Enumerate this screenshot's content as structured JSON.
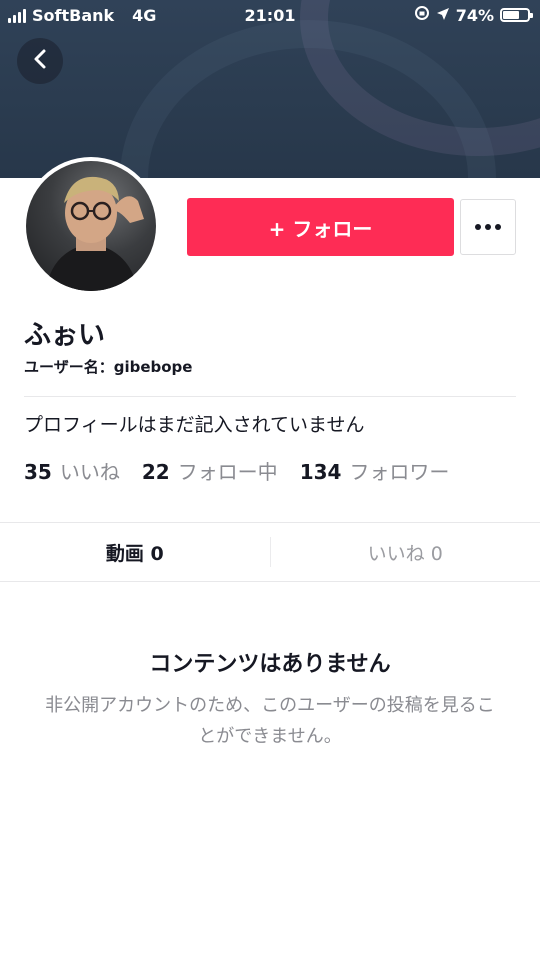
{
  "status_bar": {
    "carrier": "SoftBank",
    "network": "4G",
    "time": "21:01",
    "battery": "74%",
    "battery_level": 0.74
  },
  "header": {
    "back_icon": "chevron-left-icon"
  },
  "profile": {
    "follow_label": "+ フォロー",
    "more_icon": "more-dots-icon",
    "display_name": "ふぉい",
    "username_label": "ユーザー名：",
    "username": "gibebope",
    "bio": "プロフィールはまだ記入されていません",
    "stats": [
      {
        "value": "35",
        "label": "いいね"
      },
      {
        "value": "22",
        "label": "フォロー中"
      },
      {
        "value": "134",
        "label": "フォロワー"
      }
    ]
  },
  "tabs": [
    {
      "label": "動画 0"
    },
    {
      "label": "いいね 0"
    }
  ],
  "empty_state": {
    "title": "コンテンツはありません",
    "description": "非公開アカウントのため、このユーザーの投稿を見ることができません。"
  },
  "colors": {
    "accent": "#fe2c55",
    "banner": "#2b3c50"
  }
}
